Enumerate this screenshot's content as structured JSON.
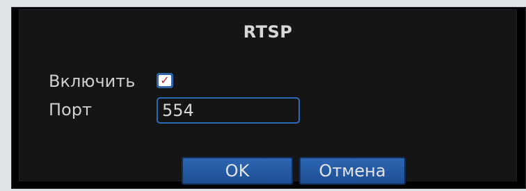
{
  "dialog": {
    "title": "RTSP",
    "enable": {
      "label": "Включить",
      "checked": true,
      "check_mark": "✓"
    },
    "port": {
      "label": "Порт",
      "value": "554"
    },
    "buttons": {
      "ok_label": "OK",
      "cancel_label": "Отмена"
    }
  }
}
